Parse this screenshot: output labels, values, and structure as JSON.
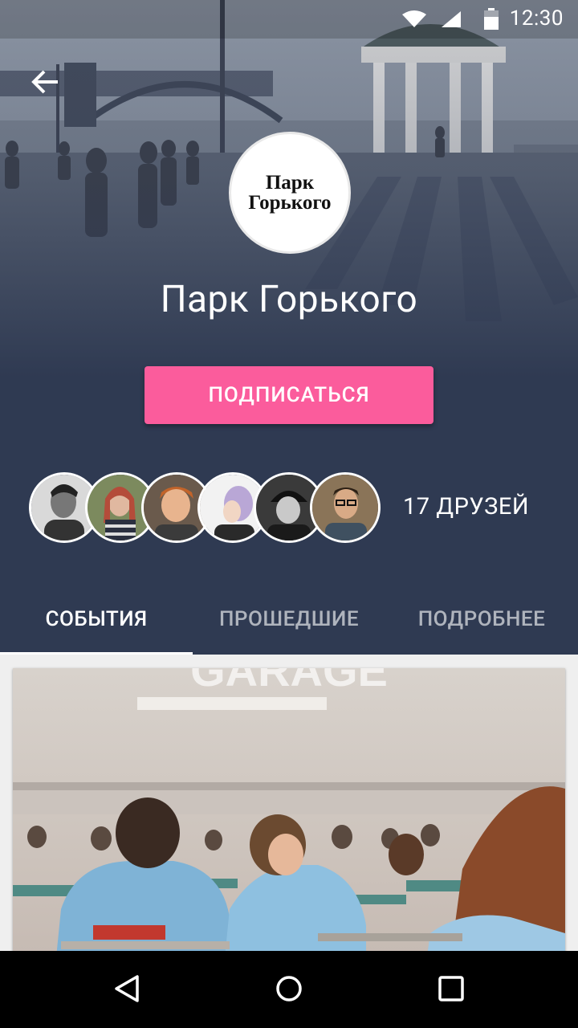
{
  "status_bar": {
    "time": "12:30"
  },
  "hero": {
    "title": "Парк Горького",
    "logo_line1": "Парк",
    "logo_line2": "Горького"
  },
  "subscribe_label": "ПОДПИСАТЬСЯ",
  "friends": {
    "count_label": "17 ДРУЗЕЙ",
    "avatars": [
      "friend-1",
      "friend-2",
      "friend-3",
      "friend-4",
      "friend-5",
      "friend-6"
    ]
  },
  "tabs": [
    {
      "label": "СОБЫТИЯ",
      "active": true
    },
    {
      "label": "ПРОШЕДШИЕ",
      "active": false
    },
    {
      "label": "ПОДРОБНЕЕ",
      "active": false
    }
  ],
  "event_card": {
    "screen_text": "GARAGE"
  },
  "icons": {
    "back": "arrow-back-icon",
    "wifi": "wifi-icon",
    "signal": "signal-icon",
    "battery": "battery-icon",
    "nav_back": "nav-back-icon",
    "nav_home": "nav-home-icon",
    "nav_recents": "nav-recents-icon"
  },
  "colors": {
    "primary": "#2f3a52",
    "accent": "#fb5c9c"
  }
}
